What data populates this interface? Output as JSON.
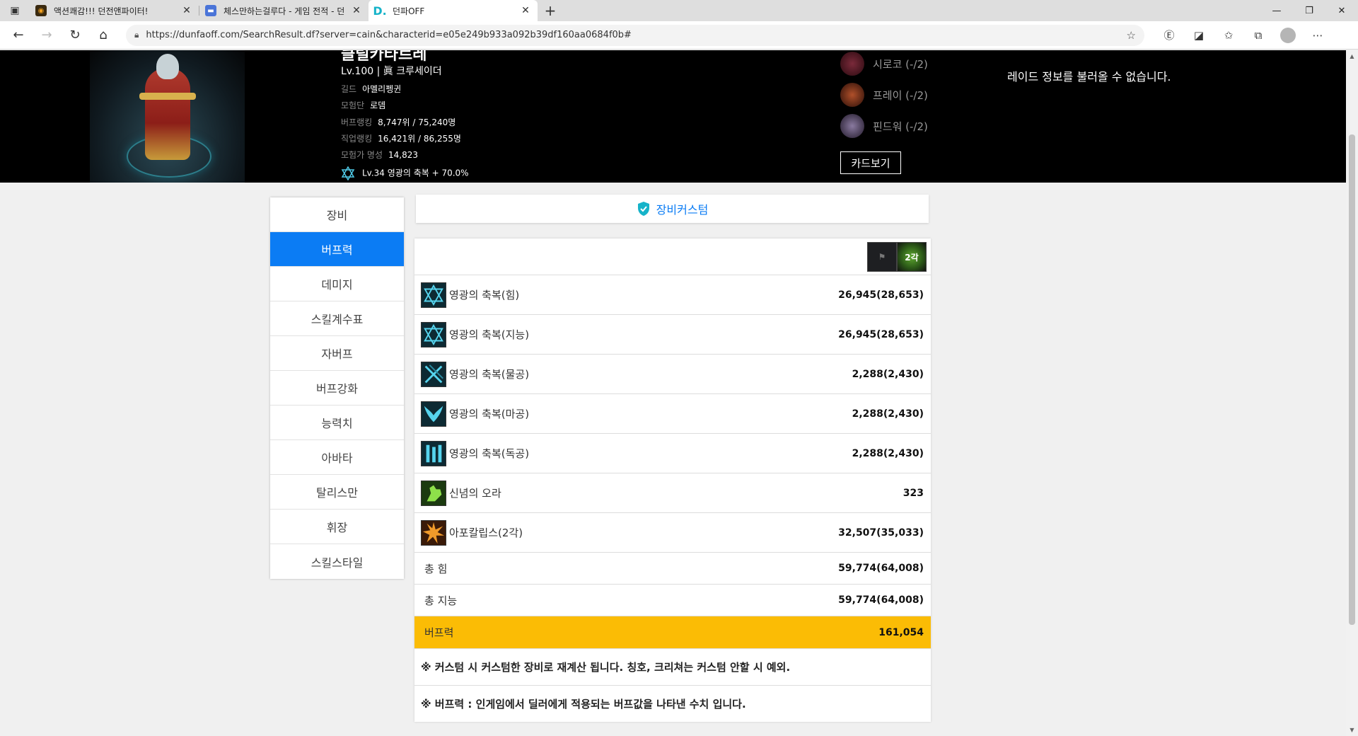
{
  "browser": {
    "tabs": [
      {
        "title": "액션쾌감!!! 던전앤파이터!",
        "active": false
      },
      {
        "title": "체스만하는걸루다 - 게임 전적 - 던",
        "active": false
      },
      {
        "title": "던파OFF",
        "active": true
      }
    ],
    "url": "https://dunfaoff.com/SearchResult.df?server=cain&characterid=e05e249b933a092b39df160aa0684f0b#"
  },
  "character": {
    "name": "클릴카타르레",
    "level_text": "Lv.100 | 眞 크루세이더",
    "guild_label": "길드",
    "guild": "아멜리펭귄",
    "adventure_label": "모험단",
    "adventure": "로뎀",
    "buff_rank_label": "버프랭킹",
    "buff_rank": "8,747위 / 75,240명",
    "job_rank_label": "직업랭킹",
    "job_rank": "16,421위 / 86,255명",
    "fame_label": "모험가 명성",
    "fame": "14,823",
    "blessing": "Lv.34 영광의 축복 + 70.0%"
  },
  "raids": [
    {
      "name": "시로코 (-/2)"
    },
    {
      "name": "프레이 (-/2)"
    },
    {
      "name": "핀드워 (-/2)"
    }
  ],
  "card_button": "카드보기",
  "raid_message": "레이드 정보를 불러올 수 없습니다.",
  "menu": [
    {
      "label": "장비",
      "active": false
    },
    {
      "label": "버프력",
      "active": true
    },
    {
      "label": "데미지",
      "active": false
    },
    {
      "label": "스킬계수표",
      "active": false
    },
    {
      "label": "자버프",
      "active": false
    },
    {
      "label": "버프강화",
      "active": false
    },
    {
      "label": "능력치",
      "active": false
    },
    {
      "label": "아바타",
      "active": false
    },
    {
      "label": "탈리스만",
      "active": false
    },
    {
      "label": "휘장",
      "active": false
    },
    {
      "label": "스킬스타일",
      "active": false
    }
  ],
  "custom_equipment": "장비커스텀",
  "card_badge": "2각",
  "buffs": [
    {
      "icon": "hexagram-icon",
      "name": "영광의 축복(힘)",
      "value": "26,945(28,653)",
      "color": "#1b9bb8"
    },
    {
      "icon": "hexagram-icon",
      "name": "영광의 축복(지능)",
      "value": "26,945(28,653)",
      "color": "#1b9bb8"
    },
    {
      "icon": "crossed-swords-icon",
      "name": "영광의 축복(물공)",
      "value": "2,288(2,430)",
      "color": "#1b9bb8"
    },
    {
      "icon": "wings-icon",
      "name": "영광의 축복(마공)",
      "value": "2,288(2,430)",
      "color": "#1b9bb8"
    },
    {
      "icon": "pillars-icon",
      "name": "영광의 축복(독공)",
      "value": "2,288(2,430)",
      "color": "#1b9bb8"
    },
    {
      "icon": "flexed-arm-icon",
      "name": "신념의 오라",
      "value": "323",
      "color": "#6cc02a"
    },
    {
      "icon": "burst-icon",
      "name": "아포칼립스(2각)",
      "value": "32,507(35,033)",
      "color": "#e07a1f"
    }
  ],
  "totals": [
    {
      "name": "총 힘",
      "value": "59,774(64,008)"
    },
    {
      "name": "총 지능",
      "value": "59,774(64,008)"
    }
  ],
  "buff_power": {
    "name": "버프력",
    "value": "161,054",
    "color": "#fbbc05"
  },
  "notes": [
    "※ 커스텀 시 커스텀한 장비로 재계산 됩니다. 칭호, 크리쳐는 커스텀 안할 시 예외.",
    "※ 버프력 : 인게임에서 딜러에게 적용되는 버프값을 나타낸 수치 입니다."
  ]
}
